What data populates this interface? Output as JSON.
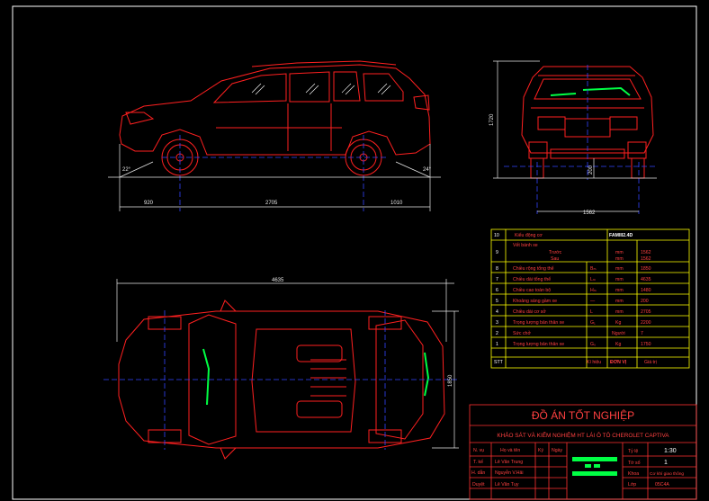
{
  "dimensions": {
    "side_front_overhang": "920",
    "side_wheelbase": "2705",
    "side_rear_overhang": "1010",
    "side_approach_angle": "22°",
    "side_departure_angle": "24°",
    "front_height": "1720",
    "front_ground_clearance": "200",
    "front_track": "1562",
    "top_length": "4635",
    "top_width": "1850"
  },
  "spec_table": {
    "rows": [
      {
        "stt": "10",
        "name": "Kiểu động cơ",
        "symbol": "",
        "unit": "",
        "value": "FAMIII2.4D"
      },
      {
        "stt": "9",
        "name": "Vết bánh xe",
        "sub1": "Trước",
        "sub2": "Sau",
        "symbol": "",
        "unit": "mm",
        "unit2": "mm",
        "value": "1562",
        "value2": "1562"
      },
      {
        "stt": "8",
        "name": "Chiều rộng tổng thể",
        "symbol": "Bₘ",
        "unit": "mm",
        "value": "1850"
      },
      {
        "stt": "7",
        "name": "Chiều dài tổng thể",
        "symbol": "Lₘ",
        "unit": "mm",
        "value": "4635"
      },
      {
        "stt": "6",
        "name": "Chiều cao toàn bộ",
        "symbol": "Hₘ",
        "unit": "mm",
        "value": "1480"
      },
      {
        "stt": "5",
        "name": "Khoảng sáng gầm xe",
        "symbol": "—",
        "unit": "mm",
        "value": "200"
      },
      {
        "stt": "4",
        "name": "Chiều dài cơ sở",
        "symbol": "L",
        "unit": "mm",
        "value": "2705"
      },
      {
        "stt": "3",
        "name": "Trọng lượng bản thân xe",
        "symbol": "G₁",
        "unit": "Kg",
        "value": "2200"
      },
      {
        "stt": "2",
        "name": "Sức chở",
        "symbol": "",
        "unit": "Người",
        "value": "7"
      },
      {
        "stt": "1",
        "name": "Trọng lượng bản thân xe",
        "symbol": "G₀",
        "unit": "Kg",
        "value": "1750"
      }
    ],
    "footer": {
      "stt": "STT",
      "ki_hieu": "Kí hiệu",
      "don_vi": "ĐƠN VỊ",
      "gia_tri": "Giá trị"
    }
  },
  "title_block": {
    "main_title": "ĐỒ ÁN TỐT NGHIỆP",
    "subtitle": "KHẢO SÁT VÀ KIỂM NGHIỆM HT LÁI Ô TÔ CHEROLET CAPTIVA",
    "header": {
      "nv": "N. vụ",
      "name": "Họ và tên",
      "ky": "Ký",
      "ngay": "Ngày"
    },
    "people": [
      {
        "role": "T. kế",
        "name": "Lê Văn Trung"
      },
      {
        "role": "H. dẫn",
        "name": "Nguyễn V.Hải"
      },
      {
        "role": "Duyệt",
        "name": "Lê Văn Tụy"
      }
    ],
    "info": [
      {
        "label": "Tỷ lệ",
        "value": "1:30"
      },
      {
        "label": "Tờ số",
        "value": "1"
      },
      {
        "label": "Khoa",
        "value": "Cơ khí giao thông"
      },
      {
        "label": "Lớp",
        "value": "05C4A"
      }
    ]
  },
  "colors": {
    "background": "#000000",
    "car_lines": "#ff2020",
    "dimension": "#e8e8e8",
    "table": "#ffff00",
    "title_block": "#ff3030",
    "accent_green": "#00ff44",
    "centerline": "#3344ff"
  }
}
